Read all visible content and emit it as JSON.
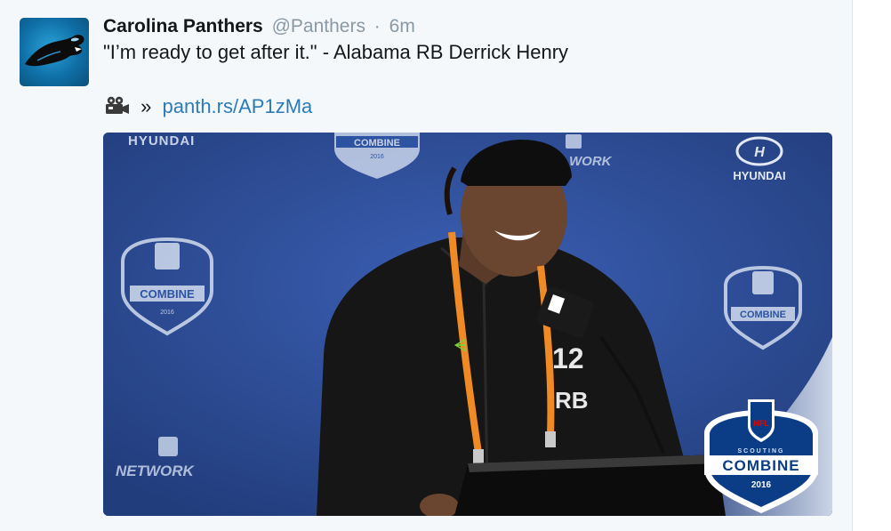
{
  "tweet": {
    "author_name": "Carolina Panthers",
    "handle": "@Panthers",
    "separator": "·",
    "time": "6m",
    "text": "\"I’m ready to get after it.\" -  Alabama RB Derrick Henry",
    "link_prefix": "»",
    "link_text": "panth.rs/AP1zMa",
    "camera_icon": "video-camera-icon"
  },
  "media": {
    "backdrop_logos": {
      "hyundai_top_left": "HYUNDAI",
      "combine_top_center": "COMBINE",
      "network_top": "WORK",
      "hyundai_top_right": "HYUNDAI",
      "combine_left": "COMBINE",
      "combine_right": "COMBINE",
      "network_bottom_left": "NETWORK",
      "year_small": "2016"
    },
    "jersey_text_1": "12",
    "jersey_text_2": "RB",
    "badge": {
      "league": "NFL",
      "small_caption": "SCOUTING",
      "title": "COMBINE",
      "year": "2016"
    },
    "colors": {
      "backdrop": "#2a4894",
      "lanyard": "#f08a24",
      "badge_blue": "#0b3d86"
    }
  }
}
